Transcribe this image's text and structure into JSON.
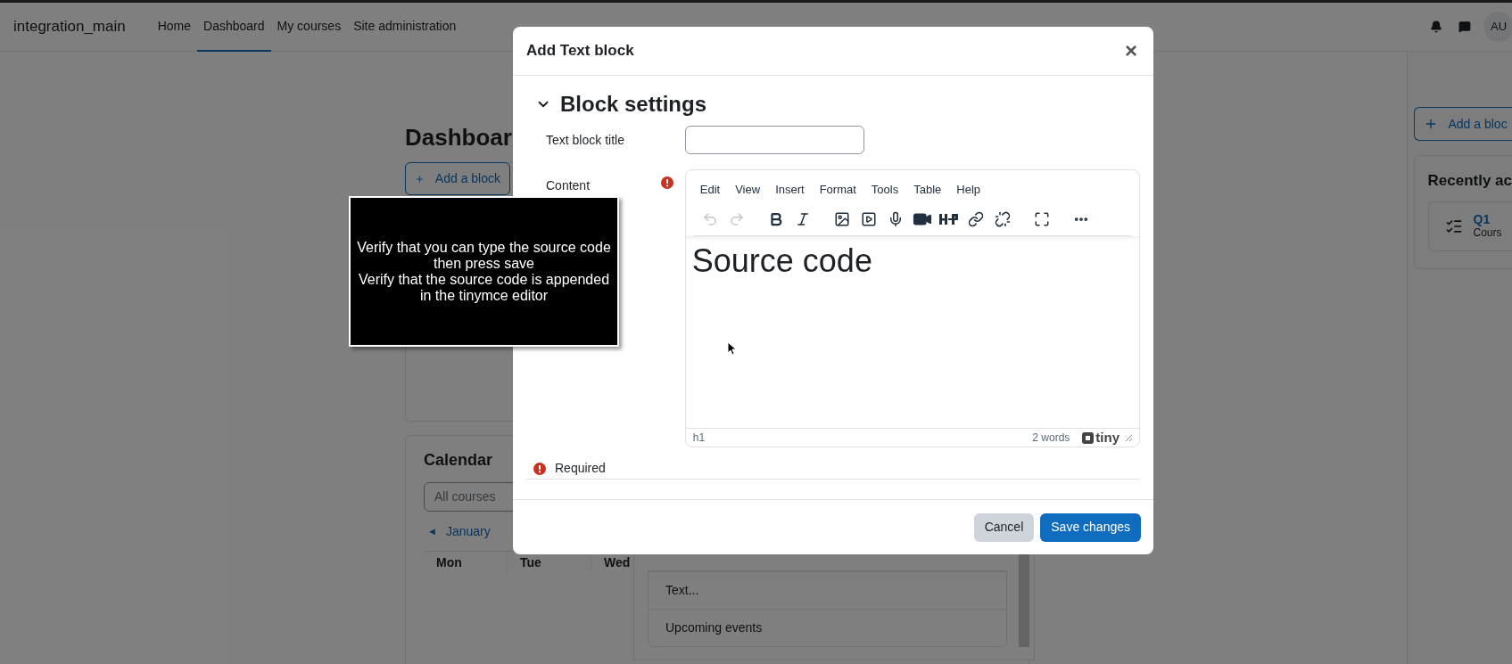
{
  "navbar": {
    "site_name": "integration_main",
    "links": [
      {
        "label": "Home",
        "selected": false
      },
      {
        "label": "Dashboard",
        "selected": true
      },
      {
        "label": "My courses",
        "selected": false
      },
      {
        "label": "Site administration",
        "selected": false
      }
    ],
    "avatar": "AU"
  },
  "page": {
    "title": "Dashboar",
    "add_block_button": "Add a block",
    "calendar": {
      "title": "Calendar",
      "course_filter": "All courses",
      "prev_arrow": "◄",
      "month_link": "January",
      "days": [
        "Mon",
        "Tue",
        "Wed"
      ]
    }
  },
  "drawer": {
    "add_block_button": "Add a bloc",
    "recent_title": "Recently ac",
    "items": [
      {
        "title": "Q1",
        "subtitle": "Cours"
      }
    ]
  },
  "block_list": {
    "items": [
      "Text...",
      "Upcoming events"
    ]
  },
  "dialog": {
    "title": "Add Text block",
    "close": "×",
    "section": {
      "title": "Block settings",
      "expanded": true
    },
    "title_field": {
      "label": "Text block title"
    },
    "content_field": {
      "label": "Content",
      "required": true,
      "menubar": [
        "Edit",
        "View",
        "Insert",
        "Format",
        "Tools",
        "Table",
        "Help"
      ],
      "toolbar": [
        {
          "kind": "undo",
          "disabled": true
        },
        {
          "kind": "redo",
          "disabled": true
        },
        {
          "kind": "sep"
        },
        {
          "kind": "bold",
          "disabled": false
        },
        {
          "kind": "italic",
          "disabled": false
        },
        {
          "kind": "sep"
        },
        {
          "kind": "image",
          "disabled": false
        },
        {
          "kind": "media",
          "disabled": false
        },
        {
          "kind": "mic",
          "disabled": false
        },
        {
          "kind": "video",
          "disabled": false
        },
        {
          "kind": "plugin",
          "disabled": false
        },
        {
          "kind": "link",
          "disabled": false
        },
        {
          "kind": "unlink",
          "disabled": false
        },
        {
          "kind": "sep"
        },
        {
          "kind": "fullscreen",
          "disabled": false
        },
        {
          "kind": "sep"
        },
        {
          "kind": "more",
          "disabled": false
        }
      ],
      "content": "Source code",
      "path": "h1",
      "word_count": "2 words",
      "brand": "tiny"
    },
    "required_note": "Required",
    "buttons": [
      {
        "label": "Cancel",
        "kind": "secondary"
      },
      {
        "label": "Save changes",
        "kind": "primary"
      }
    ]
  },
  "note": {
    "lines": [
      "Verify that you can type the source code",
      "then press save",
      "Verify that the source code is appended",
      "in the tinymce editor"
    ]
  }
}
